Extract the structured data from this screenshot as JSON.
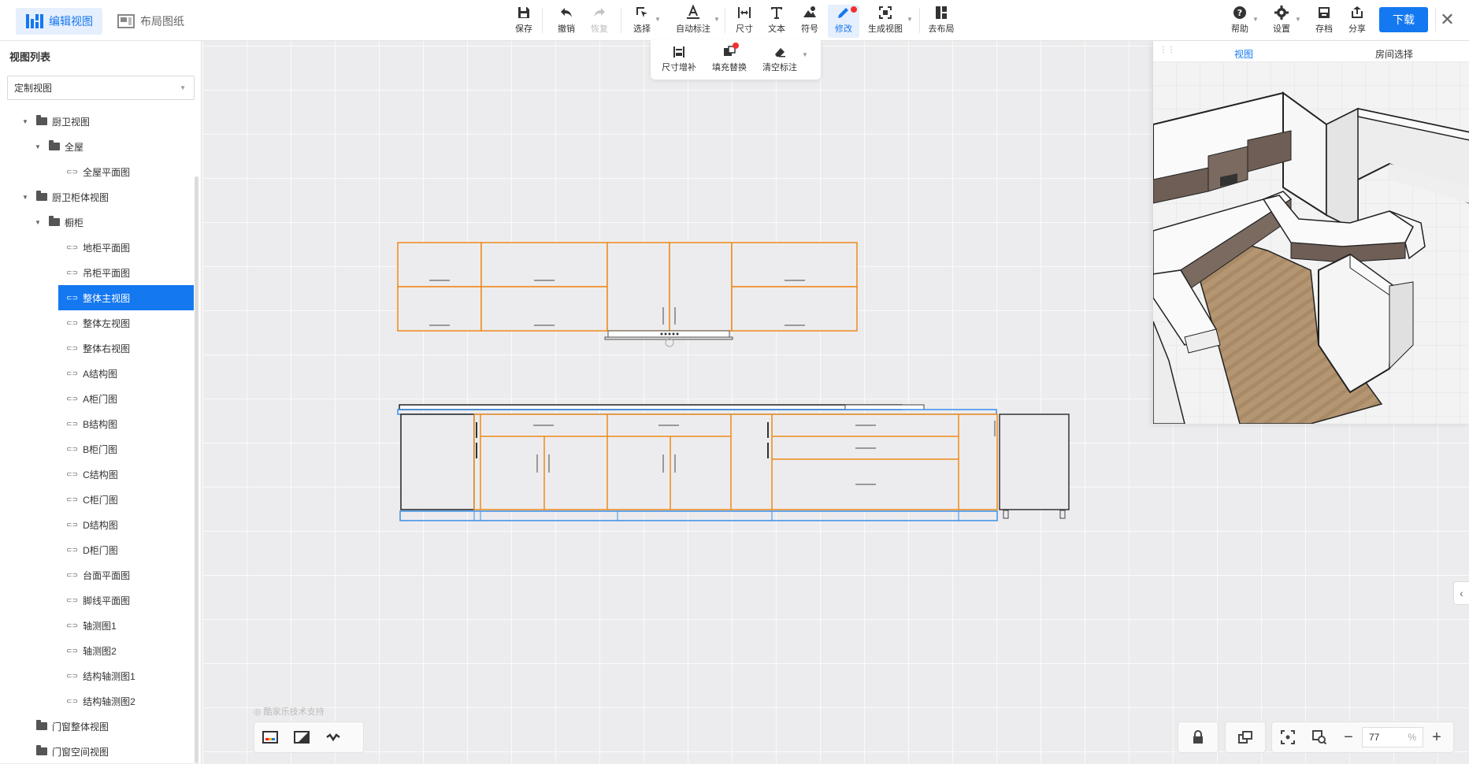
{
  "modes": [
    {
      "label": "编辑视图",
      "active": true
    },
    {
      "label": "布局图纸",
      "active": false
    }
  ],
  "toolbar": {
    "save": "保存",
    "undo": "撤销",
    "redo": "恢复",
    "select": "选择",
    "auto_dim": "自动标注",
    "dimension": "尺寸",
    "text": "文本",
    "symbol": "符号",
    "modify": "修改",
    "gen_view": "生成视图",
    "to_layout": "去布局",
    "help": "帮助",
    "settings": "设置",
    "archive": "存档",
    "share": "分享",
    "download": "下载"
  },
  "subtoolbar": {
    "dim_fill": "尺寸增补",
    "fill_replace": "填充替换",
    "clear_dim": "清空标注"
  },
  "left_panel": {
    "title": "视图列表",
    "select_value": "定制视图",
    "tree": [
      {
        "label": "厨卫视图",
        "type": "folder",
        "level": 0,
        "toggle": "▾"
      },
      {
        "label": "全屋",
        "type": "folder",
        "level": 1,
        "toggle": "▾"
      },
      {
        "label": "全屋平面图",
        "type": "link",
        "level": 2
      },
      {
        "label": "厨卫柜体视图",
        "type": "folder",
        "level": 0,
        "toggle": "▾"
      },
      {
        "label": "橱柜",
        "type": "folder",
        "level": 1,
        "toggle": "▾"
      },
      {
        "label": "地柜平面图",
        "type": "link",
        "level": 2
      },
      {
        "label": "吊柜平面图",
        "type": "link",
        "level": 2
      },
      {
        "label": "整体主视图",
        "type": "link",
        "level": 2,
        "selected": true
      },
      {
        "label": "整体左视图",
        "type": "link",
        "level": 2
      },
      {
        "label": "整体右视图",
        "type": "link",
        "level": 2
      },
      {
        "label": "A结构图",
        "type": "link",
        "level": 2
      },
      {
        "label": "A柜门图",
        "type": "link",
        "level": 2
      },
      {
        "label": "B结构图",
        "type": "link",
        "level": 2
      },
      {
        "label": "B柜门图",
        "type": "link",
        "level": 2
      },
      {
        "label": "C结构图",
        "type": "link",
        "level": 2
      },
      {
        "label": "C柜门图",
        "type": "link",
        "level": 2
      },
      {
        "label": "D结构图",
        "type": "link",
        "level": 2
      },
      {
        "label": "D柜门图",
        "type": "link",
        "level": 2
      },
      {
        "label": "台面平面图",
        "type": "link",
        "level": 2
      },
      {
        "label": "脚线平面图",
        "type": "link",
        "level": 2
      },
      {
        "label": "轴测图1",
        "type": "link",
        "level": 2
      },
      {
        "label": "轴测图2",
        "type": "link",
        "level": 2
      },
      {
        "label": "结构轴测图1",
        "type": "link",
        "level": 2
      },
      {
        "label": "结构轴测图2",
        "type": "link",
        "level": 2
      },
      {
        "label": "门窗整体视图",
        "type": "folder",
        "level": 0
      },
      {
        "label": "门窗空间视图",
        "type": "folder",
        "level": 0
      }
    ]
  },
  "preview": {
    "tab_view": "视图",
    "tab_room": "房间选择"
  },
  "watermark": "酷家乐技术支持",
  "zoom": {
    "value": "77",
    "unit": "%"
  },
  "colors": {
    "accent": "#1478f0",
    "cabinet_line": "#ee8a1a",
    "selection_line": "#3b8ee8"
  }
}
